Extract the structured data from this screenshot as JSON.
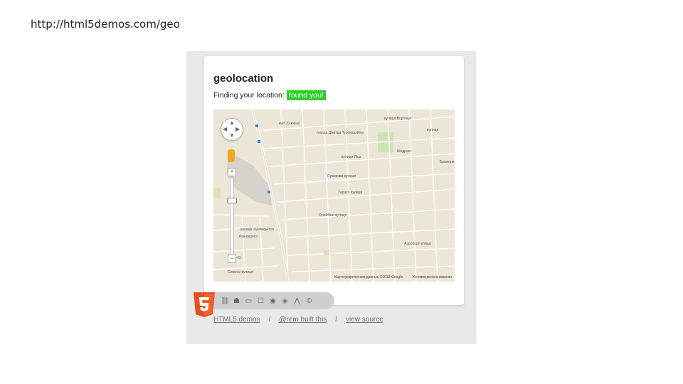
{
  "caption": {
    "url": "http://html5demos.com/geo"
  },
  "panel": {
    "title": "geolocation",
    "status_label": "Finding your location:",
    "status_value": "found you!",
    "status_color": "#2ecc27"
  },
  "map": {
    "credit": "Картографические данные ©2013 Google",
    "terms": "Условия использования",
    "street_labels": [
      "вул. Єсеніна",
      "площа Дмитра Туроюшэйлы",
      "вулиця Ліса",
      "Суворова вулиця",
      "Тарасо вулиця",
      "Олейбіни вулиця",
      "вулиця Тычинського",
      "Рак-пересо",
      "Пачкя В",
      "Аэропорт-улица",
      "вулиця Воронца",
      "вулиця",
      "Шедрані",
      "Сомени вулиця",
      "Бражиня"
    ]
  },
  "footer": {
    "icons": [
      "html5-logo-icon",
      "semantics-icon",
      "offline-icon",
      "device-access-icon",
      "connectivity-icon",
      "multimedia-icon",
      "3d-effects-icon",
      "performance-icon",
      "styling-icon"
    ],
    "links": [
      "HTML5 demos",
      "@rem built this",
      "view source"
    ],
    "separators": [
      "/",
      "/"
    ]
  }
}
